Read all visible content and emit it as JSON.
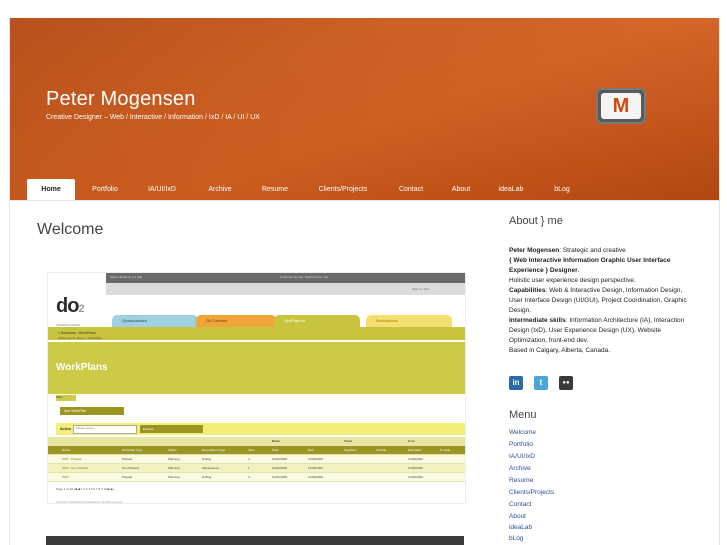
{
  "site": {
    "title": "Peter Mogensen",
    "description": "Creative Designer – Web / Interactive / Information / IxD / IA / UI / UX",
    "logo_letter": "M",
    "accent": "#c9591c"
  },
  "nav": [
    "Home",
    "Portfolio",
    "IA/UI/IxD",
    "Archive",
    "Resume",
    "Clients/Projects",
    "Contact",
    "About",
    "ideaLab",
    "bLog"
  ],
  "main": {
    "heading": "Welcome",
    "screenshot": {
      "top_left": "Sales Hierarchy 4 1 [18]",
      "top_right": "Customer for use: TechCore Co. Ltd",
      "account": "Sign In / Out",
      "brand": "do",
      "brand_super": "2",
      "brand_sub": "TECHNOLOGIES",
      "tabs": [
        "Questionnaire",
        "Oil Contract",
        "OpsPlanner",
        "Marketplace"
      ],
      "breadcrumb": "» Summary : WorkPlans",
      "location": "Where am I?: Home » WorkPlans",
      "page_title": "WorkPlans",
      "filter_label": "Filter",
      "add_button": "Add WorkPlan",
      "action_label": "Action",
      "action_placeholder": "- Please select -",
      "execute_button": "Execute",
      "group_headers": [
        "Dates",
        "Tasks",
        "Cost"
      ],
      "columns": [
        "Name",
        "WorkPlan Type",
        "Status",
        "Expenditure Type",
        "Jobs",
        "Start",
        "End",
        "Suppliers",
        "Internal",
        "Estimated",
        "To Date"
      ],
      "rows": [
        [
          "WP1 - Phased",
          "Phased",
          "Planning",
          "Drilling",
          "3",
          "10/01/2009",
          "11/30/2009",
          "",
          "",
          "11/30/2009",
          ""
        ],
        [
          "WP2 - Non-Phased",
          "Non-Phased",
          "Planning",
          "Maintenance",
          "1",
          "10/01/2009",
          "11/30/2009",
          "",
          "",
          "11/30/2009",
          ""
        ],
        [
          "WP3",
          "Phased",
          "Planning",
          "Drilling",
          "3",
          "10/01/2009",
          "11/30/2009",
          "",
          "",
          "11/30/2009",
          ""
        ]
      ],
      "pager": "Page 1 of 10  |◀ ◀ 1 2 3 4 5 6 7 8 9 10 ▶ ▶|",
      "copyright": "Copyright © 2009 DO2 Technologies Inc. All rights reserved."
    }
  },
  "sidebar": {
    "about_title": "About } me",
    "about": {
      "name": "Peter Mogensen",
      "intro": ": Strategic and creative",
      "role": "{ Web Interactive Information Graphic User Interface Experience } Designer",
      "role_tail": ".",
      "line2": "Holistic user experience design perspective.",
      "cap_label": "Capabilities",
      "cap_text": ": Web & Interactive Design, Information Design, User Interface Design (UI/GUI), Project Coordination, Graphic Design.",
      "inter_label": "Intermediate skills",
      "inter_text": ": Information Architecture (IA), Interaction Design (IxD), User Experience Design (UX), Website Optimization, front-end dev.",
      "location": "Based in Calgary, Alberta, Canada."
    },
    "social": [
      {
        "name": "linkedin-icon",
        "glyph": "in",
        "color": "#2a6aa8"
      },
      {
        "name": "twitter-icon",
        "glyph": "t",
        "color": "#4aa6d6"
      },
      {
        "name": "flickr-icon",
        "glyph": "●●",
        "color": "#3a3a3a"
      }
    ],
    "menu_title": "Menu",
    "menu": [
      "Welcome",
      "Portfolio",
      "IA/UI/IxD",
      "Archive",
      "Resume",
      "Clients/Projects",
      "Contact",
      "About",
      "ideaLab",
      "bLog"
    ]
  }
}
